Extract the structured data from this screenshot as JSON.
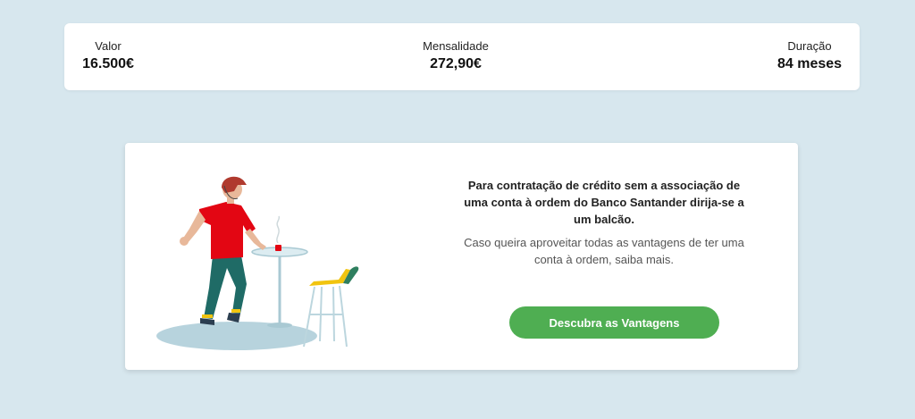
{
  "summary": {
    "valor_label": "Valor",
    "valor_value": "16.500€",
    "mensalidade_label": "Mensalidade",
    "mensalidade_value": "272,90€",
    "duracao_label": "Duração",
    "duracao_value": "84 meses"
  },
  "card": {
    "title": "Para contratação de crédito sem a associação de uma conta à ordem do Banco Santander dirija-se a um balcão.",
    "text": "Caso queira aproveitar todas as vantagens de ter uma conta à ordem, saiba mais.",
    "button_label": "Descubra as Vantagens",
    "illustration": "person-at-cafe-table-illustration"
  },
  "colors": {
    "background": "#d7e7ee",
    "button": "#4fae52",
    "shirt": "#e30613",
    "pants": "#1f6b66"
  }
}
